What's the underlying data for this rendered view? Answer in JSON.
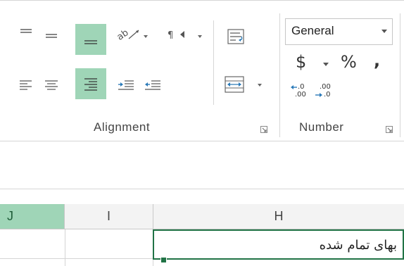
{
  "ribbon": {
    "alignment_group_label": "Alignment",
    "number_group_label": "Number",
    "number_format_value": "General",
    "currency_symbol": "$",
    "percent_symbol": "%",
    "comma_symbol": ",",
    "increase_decimal_top": ".0",
    "increase_decimal_bottom": ".00",
    "decrease_decimal_top": ".00",
    "decrease_decimal_bottom": ".0",
    "icons": [
      "top-align-icon",
      "middle-align-icon",
      "bottom-align-icon",
      "orientation-icon",
      "text-direction-icon",
      "wrap-text-icon",
      "align-left-icon",
      "center-icon",
      "align-right-icon",
      "decrease-indent-icon",
      "increase-indent-icon",
      "merge-center-icon",
      "accounting-format-icon",
      "percent-style-icon",
      "comma-style-icon",
      "increase-decimal-icon",
      "decrease-decimal-icon",
      "dialog-launcher-icon"
    ],
    "selected_color": "#9fd5b7"
  },
  "sheet": {
    "columns": [
      {
        "label": "J",
        "active": true
      },
      {
        "label": "I",
        "active": false
      },
      {
        "label": "H",
        "active": false
      }
    ],
    "active_cell_text": "بهای تمام شده",
    "active_cell_border_color": "#217346"
  }
}
